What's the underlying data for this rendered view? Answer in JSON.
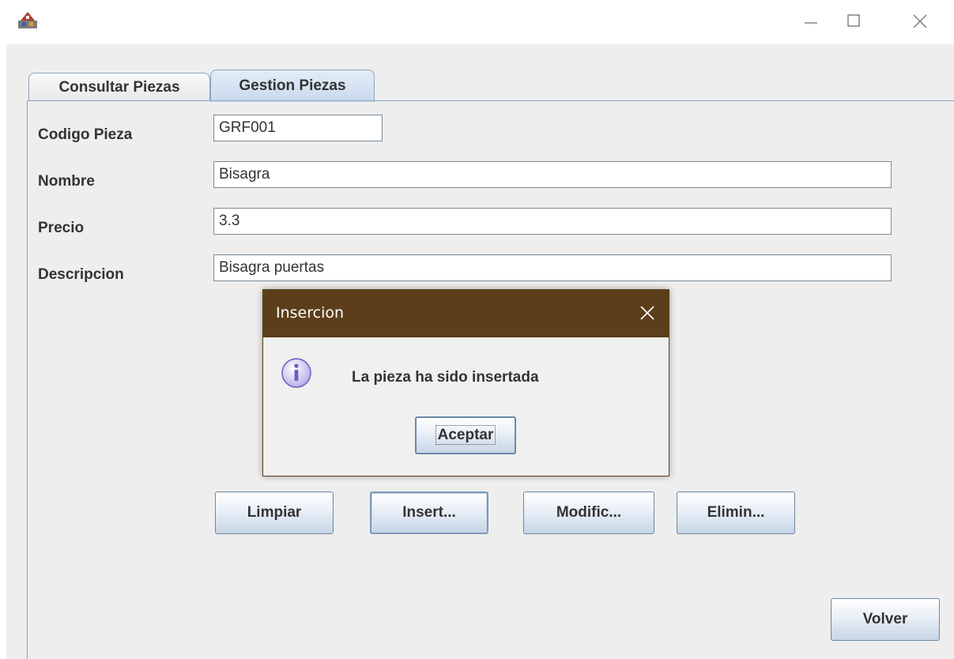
{
  "window": {
    "icon": "java-app-icon",
    "minimize_icon": "minimize-icon",
    "maximize_icon": "maximize-icon",
    "close_icon": "close-icon"
  },
  "tabs": [
    {
      "label": "Consultar Piezas",
      "active": false
    },
    {
      "label": "Gestion Piezas",
      "active": true
    }
  ],
  "form": {
    "codigo_label": "Codigo Pieza",
    "codigo_value": "GRF001",
    "nombre_label": "Nombre",
    "nombre_value": "Bisagra",
    "precio_label": "Precio",
    "precio_value": "3.3",
    "descripcion_label": "Descripcion",
    "descripcion_value": "Bisagra puertas"
  },
  "buttons": {
    "limpiar": "Limpiar",
    "insertar": "Insert...",
    "modificar": "Modific...",
    "eliminar": "Elimin...",
    "volver": "Volver"
  },
  "dialog": {
    "title": "Insercion",
    "message": "La pieza ha sido insertada",
    "ok_label": "Aceptar",
    "icon": "info-icon"
  },
  "colors": {
    "dialog_title_bar": "#5c3f1a",
    "tab_active": "#c8d9ee",
    "button_gradient_end": "#c6d5e6"
  }
}
